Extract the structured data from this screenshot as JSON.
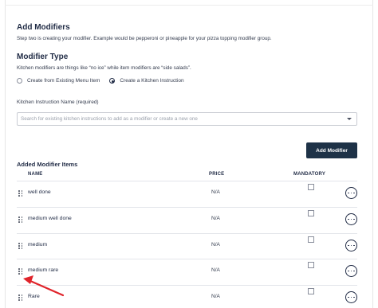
{
  "add_modifiers": {
    "title": "Add Modifiers",
    "description": "Step two is creating your modifier. Example would be pepperoni or pineapple for your pizza topping modifier group."
  },
  "modifier_type": {
    "title": "Modifier Type",
    "description": "Kitchen modifiers are things like “no ice” while item modifiers are “side salads”.",
    "options": [
      {
        "label": "Create from Existing Menu Item",
        "selected": false
      },
      {
        "label": "Create a Kitchen Instruction",
        "selected": true
      }
    ]
  },
  "kitchen_instruction": {
    "label": "Kitchen Instruction Name (required)",
    "placeholder": "Search for existing kitchen instructions to add as a modifier or create a new one"
  },
  "add_button": {
    "label": "Add Modifier"
  },
  "added_items": {
    "title": "Added Modifier Items",
    "columns": {
      "name": "NAME",
      "price": "PRICE",
      "mandatory": "MANDATORY"
    },
    "rows": [
      {
        "name": "well done",
        "price": "N/A",
        "mandatory": false
      },
      {
        "name": "medium well done",
        "price": "N/A",
        "mandatory": false
      },
      {
        "name": "medium",
        "price": "N/A",
        "mandatory": false
      },
      {
        "name": "medium rare",
        "price": "N/A",
        "mandatory": false
      },
      {
        "name": "Rare",
        "price": "N/A",
        "mandatory": false
      }
    ]
  },
  "colors": {
    "primary_button": "#1e3247",
    "annotation_arrow": "#e0242b",
    "text": "#1f2a44"
  },
  "icons": {
    "drag": "drag-handle-icon",
    "more": "more-options-icon",
    "caret": "chevron-down-icon",
    "annotation": "red-arrow-annotation"
  }
}
